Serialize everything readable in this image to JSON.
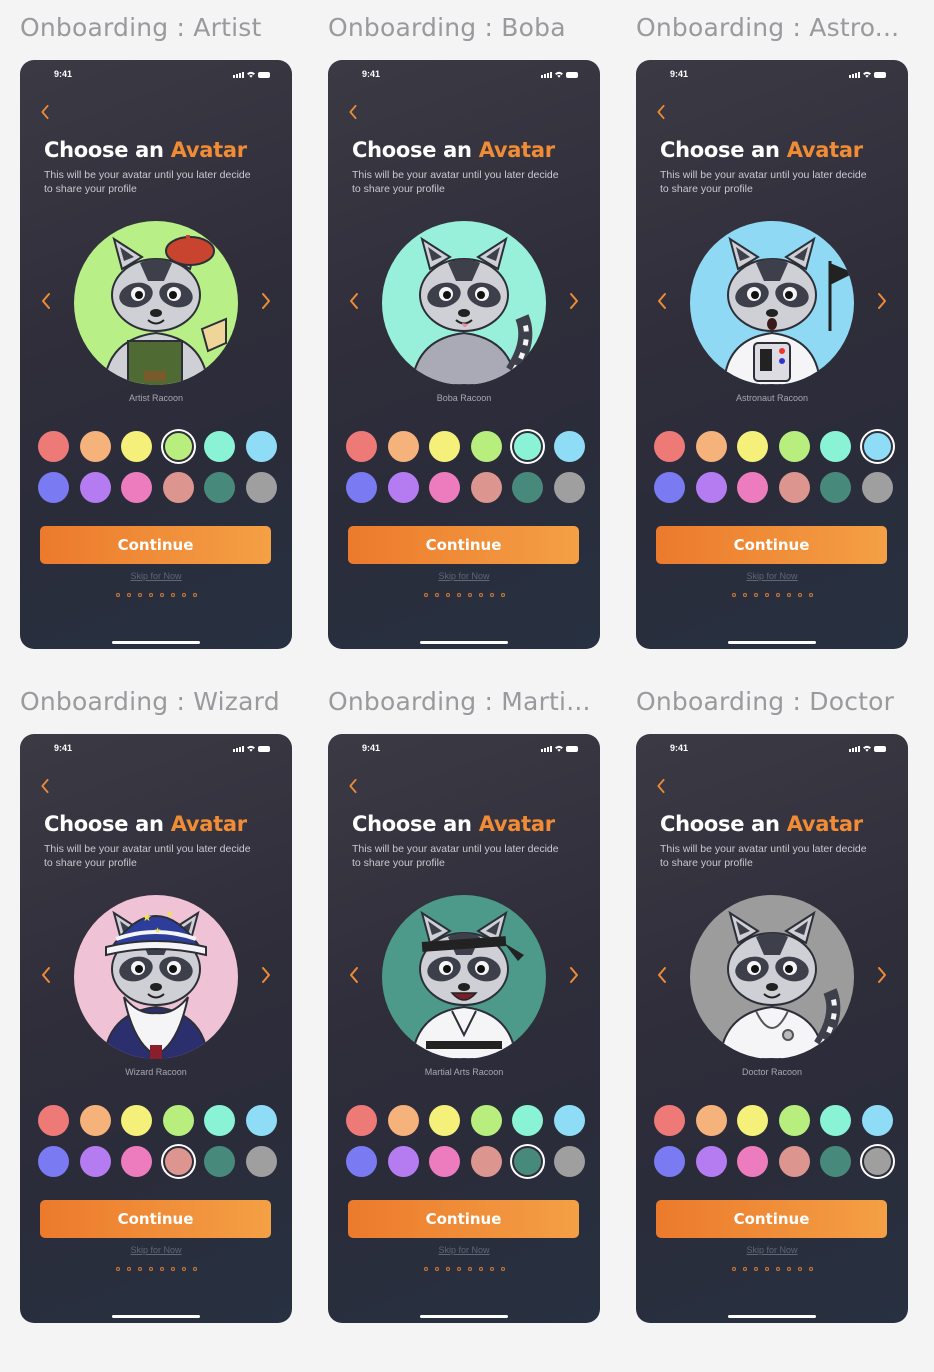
{
  "frames": [
    {
      "label": "Onboarding : Artist",
      "avatar_name": "Artist Racoon",
      "bg": "#b8ef86",
      "costume": "artist",
      "selected_swatch": 3
    },
    {
      "label": "Onboarding : Boba",
      "avatar_name": "Boba Racoon",
      "bg": "#98f0da",
      "costume": "boba",
      "selected_swatch": 4
    },
    {
      "label": "Onboarding : Astro...",
      "avatar_name": "Astronaut Racoon",
      "bg": "#8fd9f5",
      "costume": "astro",
      "selected_swatch": 5
    },
    {
      "label": "Onboarding : Wizard",
      "avatar_name": "Wizard Racoon",
      "bg": "#f0c2d6",
      "costume": "wizard",
      "selected_swatch": 9
    },
    {
      "label": "Onboarding : Marti...",
      "avatar_name": "Martial Arts Racoon",
      "bg": "#4d9a8a",
      "costume": "martial",
      "selected_swatch": 10
    },
    {
      "label": "Onboarding : Doctor",
      "avatar_name": "Doctor Racoon",
      "bg": "#9c9c9c",
      "costume": "doctor",
      "selected_swatch": 11
    }
  ],
  "screen": {
    "time": "9:41",
    "title_prefix": "Choose an",
    "title_accent": "Avatar",
    "subtitle": "This will be your avatar until you later decide to share your profile",
    "continue_label": "Continue",
    "skip_label": "Skip for Now",
    "page_dot_count": 8
  },
  "swatch_colors": [
    "#ee7a78",
    "#f5b27a",
    "#f4f07a",
    "#b8ee7e",
    "#8af2d5",
    "#8fdcf6",
    "#7a7bf2",
    "#b57cf2",
    "#ec7cbd",
    "#dd958f",
    "#478a7c",
    "#9f9f9f"
  ],
  "colors": {
    "accent": "#f08c35",
    "button_start": "#ec7a2c",
    "button_end": "#f4a045"
  },
  "icons": {
    "back": "chevron-left-icon",
    "prev": "chevron-left-icon",
    "next": "chevron-right-icon"
  }
}
